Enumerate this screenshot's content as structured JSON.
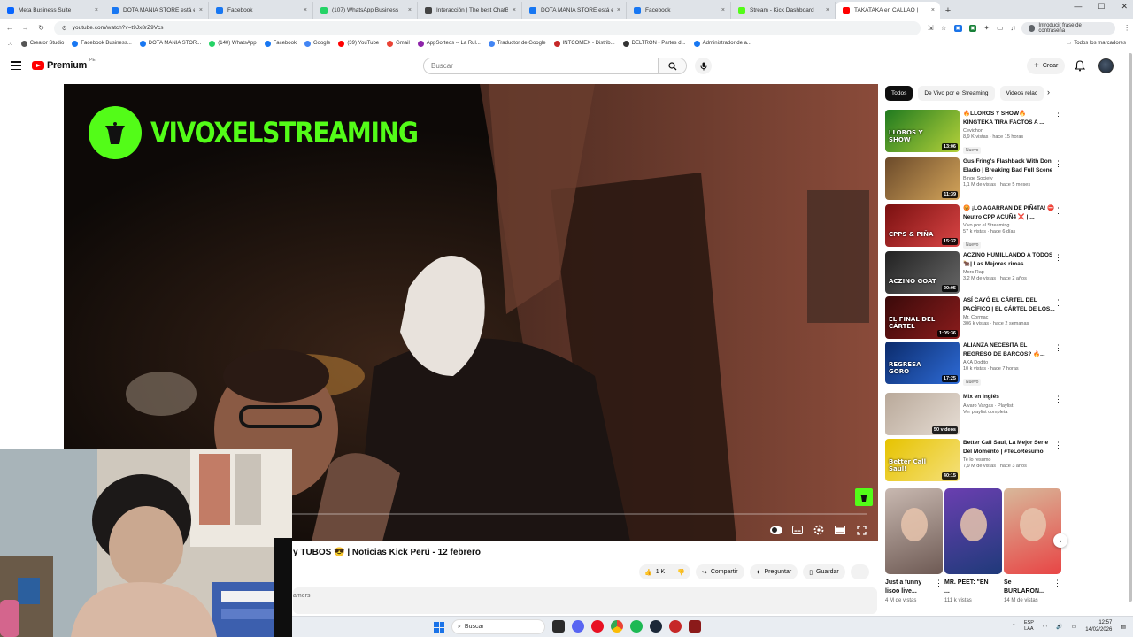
{
  "browser": {
    "tabs": [
      {
        "title": "Meta Business Suite",
        "color": "#0866ff",
        "active": false
      },
      {
        "title": "DOTA MANIA STORE está en Fa",
        "color": "#1877f2",
        "active": false
      },
      {
        "title": "Facebook",
        "color": "#1877f2",
        "active": false
      },
      {
        "title": "(107) WhatsApp Business",
        "color": "#25d366",
        "active": false
      },
      {
        "title": "Interacción | The best ChatBot",
        "color": "#444444",
        "active": false
      },
      {
        "title": "DOTA MANIA STORE está en Fa",
        "color": "#1877f2",
        "active": false
      },
      {
        "title": "Facebook",
        "color": "#1877f2",
        "active": false
      },
      {
        "title": "Stream - Kick Dashboard",
        "color": "#53fc18",
        "active": false
      },
      {
        "title": "TAKATAKA en CALLAO |",
        "color": "#ff0000",
        "active": true
      }
    ],
    "url": "youtube.com/watch?v=t9Jx8rZ9Vcs",
    "passkey_label": "Introducir frase de contraseña",
    "bookmarks": [
      {
        "label": "Creator Studio",
        "color": "#555555"
      },
      {
        "label": "Facebook Business...",
        "color": "#1877f2"
      },
      {
        "label": "DOTA MANIA STOR...",
        "color": "#1877f2"
      },
      {
        "label": "(140) WhatsApp",
        "color": "#25d366"
      },
      {
        "label": "Facebook",
        "color": "#1877f2"
      },
      {
        "label": "Google",
        "color": "#4285f4"
      },
      {
        "label": "(39) YouTube",
        "color": "#ff0000"
      },
      {
        "label": "Gmail",
        "color": "#ea4335"
      },
      {
        "label": "AppSorteos -- La Rul...",
        "color": "#8e24aa"
      },
      {
        "label": "Traductor de Google",
        "color": "#4285f4"
      },
      {
        "label": "INTCOMEX - Distrib...",
        "color": "#c62828"
      },
      {
        "label": "DELTRON - Partes d...",
        "color": "#333333"
      },
      {
        "label": "Administrador de a...",
        "color": "#1877f2"
      }
    ],
    "all_bookmarks_label": "Todos los marcadores"
  },
  "youtube": {
    "brand": "Premium",
    "region": "PE",
    "search_placeholder": "Buscar",
    "create_label": "Crear"
  },
  "player": {
    "watermark_text": "VIVOXELSTREAMING"
  },
  "video": {
    "title": "y TUBOS 😎 | Noticias Kick Perú - 12 febrero",
    "channel_fragment": "amers",
    "likes": "1 K",
    "share_label": "Compartir",
    "ask_label": "Preguntar",
    "save_label": "Guardar"
  },
  "sidebar": {
    "chips": [
      "Todos",
      "De Vivo por el Streaming",
      "Videos relac"
    ],
    "recommendations": [
      {
        "title": "🔥LLOROS Y SHOW🔥 KINGTEKA TIRA FACTOS A ...",
        "channel": "Cevichon",
        "meta": "8,9 K vistas · hace 15 horas",
        "badge": "Nuevo",
        "duration": "13:06",
        "thumb_text": "LLOROS Y SHOW",
        "thumb_colors": [
          "#1f7a1f",
          "#b5d13a"
        ]
      },
      {
        "title": "Gus Fring's Flashback With Don Eladio | Breaking Bad Full Scene",
        "channel": "Binge Society",
        "meta": "1,1 M de vistas · hace 5 meses",
        "badge": "",
        "duration": "11:39",
        "thumb_text": "",
        "thumb_colors": [
          "#6b4a2a",
          "#d3a45a"
        ]
      },
      {
        "title": "😡 ¡LO AGARRAN DE PIÑ4TA! ⛔ Neutro CPP ACUÑ4 ❌ | ...",
        "channel": "Vivo por el Streaming",
        "meta": "57 k vistas · hace 6 días",
        "badge": "Nuevo",
        "duration": "15:32",
        "thumb_text": "CPPS & PIÑA",
        "thumb_colors": [
          "#7a1010",
          "#d94545"
        ]
      },
      {
        "title": "ACZINO HUMILLANDO A TODOS 🐂| Las Mejores rimas...",
        "channel": "Mors Rap",
        "meta": "3,2 M de vistas · hace 2 años",
        "badge": "",
        "duration": "20:05",
        "thumb_text": "ACZINO GOAT",
        "thumb_colors": [
          "#222222",
          "#666666"
        ]
      },
      {
        "title": "ASÍ CAYÓ EL CÁRTEL DEL PACÍFICO | EL CÁRTEL DE LOS...",
        "channel": "Mr. Cormac",
        "meta": "306 k vistas · hace 2 semanas",
        "badge": "",
        "duration": "1:05:36",
        "thumb_text": "EL FINAL DEL CÁRTEL",
        "thumb_colors": [
          "#3a0a0a",
          "#8a1c1c"
        ]
      },
      {
        "title": "ALIANZA NECESITA EL REGRESO DE BARCOS? 🔥...",
        "channel": "AKA Dodito",
        "meta": "10 k vistas · hace 7 horas",
        "badge": "Nuevo",
        "duration": "17:25",
        "thumb_text": "REGRESA GORO",
        "thumb_colors": [
          "#0b2b6b",
          "#2e6bd6"
        ]
      },
      {
        "title": "Mix en inglés",
        "channel": "Alvaro Vargas · Playlist",
        "meta": "Ver playlist completa",
        "badge": "",
        "duration": "50 videos",
        "thumb_text": "",
        "thumb_colors": [
          "#b9a99a",
          "#e6ddd4"
        ]
      },
      {
        "title": "Better Call Saul, La Mejor Serie Del Momento | #TeLoResumo",
        "channel": "Te lo resumo",
        "meta": "7,9 M de vistas · hace 3 años",
        "badge": "",
        "duration": "40:15",
        "thumb_text": "Better Call Saul!",
        "thumb_colors": [
          "#e6c300",
          "#f5e07a"
        ]
      }
    ],
    "shorts": [
      {
        "title": "Just a funny lisoo live...",
        "views": "4 M de vistas",
        "colors": [
          "#c8b8b0",
          "#6e5a54"
        ]
      },
      {
        "title": "MR. PEET: \"EN ...",
        "views": "111 k vistas",
        "colors": [
          "#6a3fb0",
          "#1f3a7a"
        ]
      },
      {
        "title": "Se BURLARON...",
        "views": "14 M de vistas",
        "colors": [
          "#d8b89a",
          "#e84545"
        ]
      }
    ]
  },
  "taskbar": {
    "search_placeholder": "Buscar",
    "lang_top": "ESP",
    "lang_bottom": "LAA",
    "time": "12:57",
    "date": "14/02/2026"
  }
}
